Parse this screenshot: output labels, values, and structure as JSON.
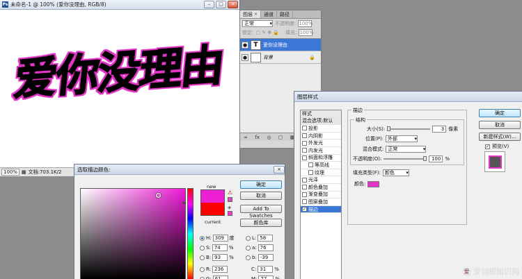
{
  "doc": {
    "title": "未命名-1 @ 100% (爱你没理由, RGB/8)",
    "artwork_text": "爱你没理由",
    "status_zoom": "100%",
    "status_doc": "文档:703.1K/2"
  },
  "layers_panel": {
    "tabs": [
      "图层",
      "通道",
      "路径"
    ],
    "blend_mode": "正常",
    "opacity_label": "不透明度:",
    "opacity_value": "100%",
    "lock_label": "锁定:",
    "fill_label": "填充:",
    "fill_value": "100%",
    "layers": [
      {
        "name": "爱你没理由",
        "thumb": "T"
      },
      {
        "name": "背景"
      }
    ],
    "footer_icons": [
      "fx",
      "◎",
      "▢",
      "▦",
      "⊡",
      "⊟"
    ]
  },
  "color_picker": {
    "title": "选取描边颜色:",
    "new_label": "new",
    "current_label": "current",
    "new_color": "#ec1fd2",
    "current_color": "#ff0000",
    "buttons": {
      "ok": "确定",
      "cancel": "取消",
      "add_swatches": "Add To Swatches",
      "libraries": "颜色库"
    },
    "values": {
      "H": {
        "label": "H:",
        "value": "309",
        "unit": "度"
      },
      "S": {
        "label": "S:",
        "value": "74",
        "unit": "%"
      },
      "B": {
        "label": "B:",
        "value": "93",
        "unit": "%"
      },
      "R": {
        "label": "R:",
        "value": "236"
      },
      "G": {
        "label": "G:",
        "value": "61"
      },
      "L": {
        "label": "L:",
        "value": "58"
      },
      "a": {
        "label": "a:",
        "value": "76"
      },
      "b": {
        "label": "b:",
        "value": "-39"
      },
      "C": {
        "label": "C:",
        "value": "31",
        "unit": "%"
      },
      "M": {
        "label": "M:",
        "value": "77",
        "unit": "%"
      }
    }
  },
  "layer_style": {
    "title": "图层样式",
    "list_header": "样式",
    "blend_header": "混合选项:默认",
    "items": [
      {
        "label": "投影",
        "checked": false
      },
      {
        "label": "内阴影",
        "checked": false
      },
      {
        "label": "外发光",
        "checked": false
      },
      {
        "label": "内发光",
        "checked": false
      },
      {
        "label": "斜面和浮雕",
        "checked": false
      },
      {
        "label": "等高线",
        "checked": false,
        "sub": true
      },
      {
        "label": "纹理",
        "checked": false,
        "sub": true
      },
      {
        "label": "光泽",
        "checked": false
      },
      {
        "label": "颜色叠加",
        "checked": false
      },
      {
        "label": "渐变叠加",
        "checked": false
      },
      {
        "label": "图案叠加",
        "checked": false
      },
      {
        "label": "描边",
        "checked": true,
        "selected": true
      }
    ],
    "section_title": "描边",
    "structure_title": "结构",
    "size_label": "大小(S):",
    "size_value": "3",
    "size_unit": "像素",
    "position_label": "位置(P):",
    "position_value": "外部",
    "blend_label": "混合模式:",
    "blend_value": "正常",
    "opacity_label": "不透明度(O):",
    "opacity_value": "100",
    "opacity_unit": "%",
    "fill_type_label": "填充类型(F):",
    "fill_type_value": "颜色",
    "color_label": "颜色:",
    "stroke_color": "#e336c6",
    "buttons": {
      "ok": "确定",
      "cancel": "取消",
      "new_style": "新建样式(W)...",
      "preview": "预览(V)"
    },
    "preview_checked": true
  },
  "watermark": {
    "text": "爱创根知识网",
    "logo": "爱"
  }
}
